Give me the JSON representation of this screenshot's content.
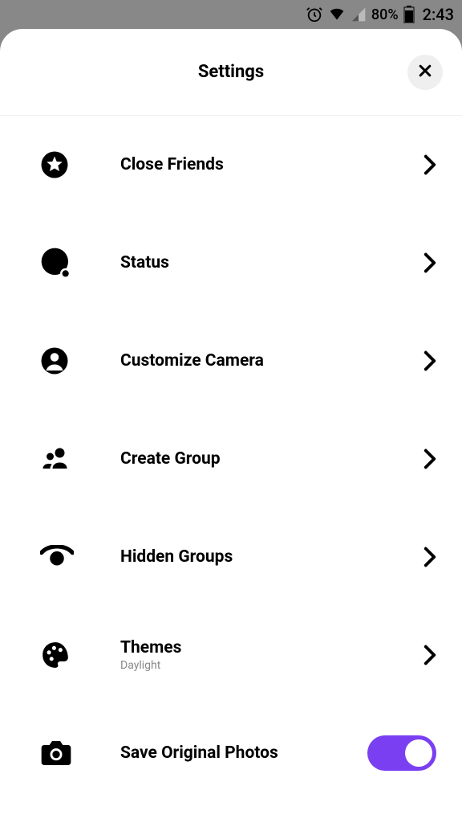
{
  "status_bar": {
    "battery_percent": "80%",
    "time": "2:43"
  },
  "header": {
    "title": "Settings"
  },
  "items": [
    {
      "icon": "star-circle-icon",
      "label": "Close Friends",
      "sublabel": "",
      "right": "chevron"
    },
    {
      "icon": "status-icon",
      "label": "Status",
      "sublabel": "",
      "right": "chevron"
    },
    {
      "icon": "person-circle-icon",
      "label": "Customize Camera",
      "sublabel": "",
      "right": "chevron"
    },
    {
      "icon": "group-icon",
      "label": "Create Group",
      "sublabel": "",
      "right": "chevron"
    },
    {
      "icon": "eye-icon",
      "label": "Hidden Groups",
      "sublabel": "",
      "right": "chevron"
    },
    {
      "icon": "palette-icon",
      "label": "Themes",
      "sublabel": "Daylight",
      "right": "chevron"
    },
    {
      "icon": "camera-icon",
      "label": "Save Original Photos",
      "sublabel": "",
      "right": "toggle",
      "toggle_on": true
    }
  ]
}
